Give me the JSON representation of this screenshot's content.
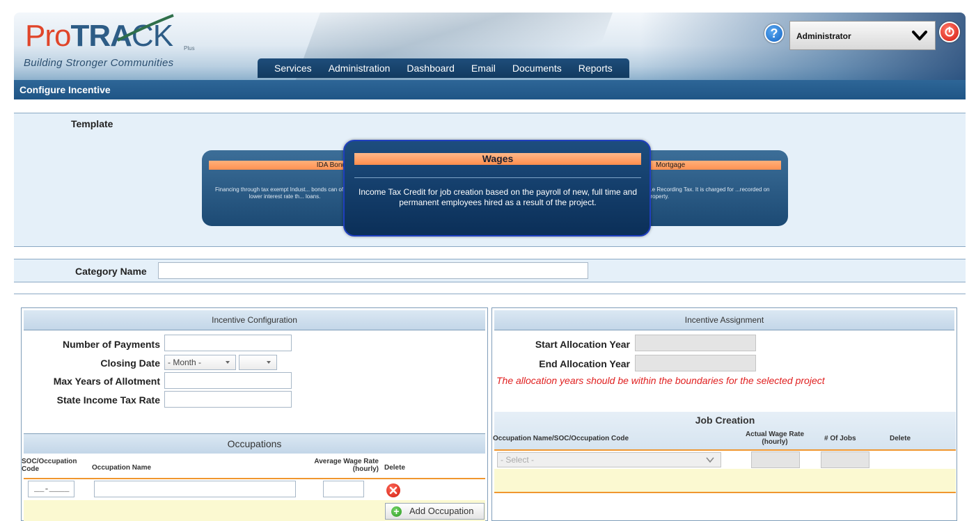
{
  "app": {
    "logo_text_pro": "Pro",
    "logo_text_track": "TRA",
    "logo_text_ck": "CK",
    "logo_plus": "Plus",
    "tagline": "Building Stronger Communities",
    "help_symbol": "?",
    "user_role": "Administrator",
    "icons": [
      "logo-swoosh-icon",
      "help-icon",
      "chevron-down-icon",
      "power-icon"
    ]
  },
  "nav": {
    "items": [
      "Services",
      "Administration",
      "Dashboard",
      "Email",
      "Documents",
      "Reports"
    ]
  },
  "page": {
    "title": "Configure Incentive"
  },
  "template": {
    "label": "Template",
    "cards": {
      "left": {
        "title": "IDA Bonds",
        "description": "Financing through tax exempt Indust... bonds can offer a lower interest rate th... loans."
      },
      "center": {
        "title": "Wages",
        "description": "Income Tax Credit for job creation based on the payroll of new, full time and permanent employees hired as a result of the project."
      },
      "right": {
        "title": "Mortgage",
        "description": "...e Recording Tax. It is charged for ...recorded on property."
      }
    }
  },
  "category": {
    "label": "Category Name",
    "value": ""
  },
  "incentive_configuration": {
    "title": "Incentive Configuration",
    "number_of_payments_label": "Number of Payments",
    "closing_date_label": "Closing Date",
    "closing_month_value": "- Month -",
    "closing_year_value": "",
    "max_years_label": "Max Years of Allotment",
    "state_tax_rate_label": "State Income Tax Rate"
  },
  "occupations": {
    "title": "Occupations",
    "columns": {
      "code": "SOC/Occupation Code",
      "name": "Occupation Name",
      "wage": "Average Wage Rate (hourly)",
      "delete": "Delete"
    },
    "row": {
      "code_mask": "__-____",
      "name": "",
      "wage": ""
    },
    "add_button_label": "Add Occupation"
  },
  "incentive_assignment": {
    "title": "Incentive Assignment",
    "start_year_label": "Start Allocation Year",
    "end_year_label": "End Allocation Year",
    "warning": "The allocation years should be within the boundaries for the selected project"
  },
  "job_creation": {
    "title": "Job Creation",
    "columns": {
      "occupation": "Occupation Name/SOC/Occupation Code",
      "wage": "Actual Wage Rate (hourly)",
      "jobs": "# Of Jobs",
      "delete": "Delete"
    },
    "select_placeholder": "- Select -"
  },
  "colors": {
    "header_dark": "#1f5586",
    "card_orange": "#ff9152",
    "warning_red": "#e02020",
    "panel_bg": "#e5f0f9",
    "grid_yellow": "#fbf9d1"
  }
}
